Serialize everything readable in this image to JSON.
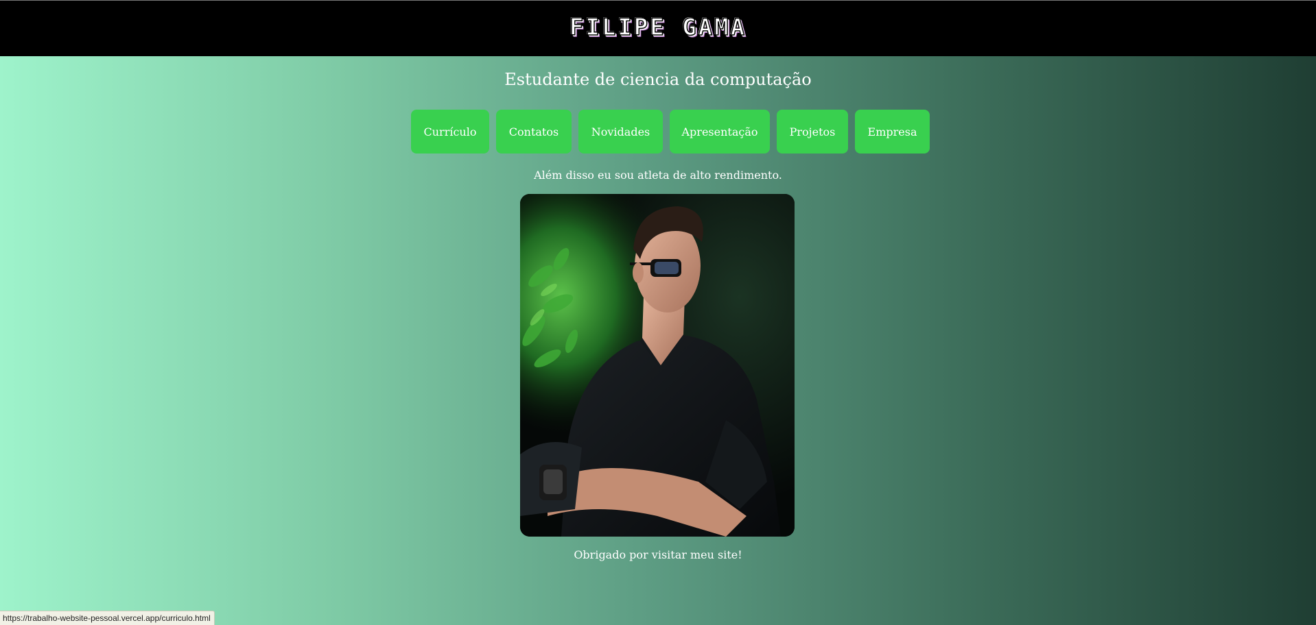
{
  "header": {
    "logo_text": "FILIPE GAMA"
  },
  "subtitle": "Estudante de ciencia da computação",
  "nav": {
    "items": [
      {
        "label": "Currículo"
      },
      {
        "label": "Contatos"
      },
      {
        "label": "Novidades"
      },
      {
        "label": "Apresentação"
      },
      {
        "label": "Projetos"
      },
      {
        "label": "Empresa"
      }
    ]
  },
  "caption": "Além disso eu sou atleta de alto rendimento.",
  "photo": {
    "subject": "man-in-sunglasses-portrait"
  },
  "footer_text": "Obrigado por visitar meu site!",
  "status_bar": {
    "url": "https://trabalho-website-pessoal.vercel.app/curriculo.html"
  },
  "colors": {
    "header_bg": "#000000",
    "button_bg": "#39d04f",
    "gradient_start": "#9ef3cb",
    "gradient_end": "#1f3e33",
    "text": "#ffffff"
  }
}
